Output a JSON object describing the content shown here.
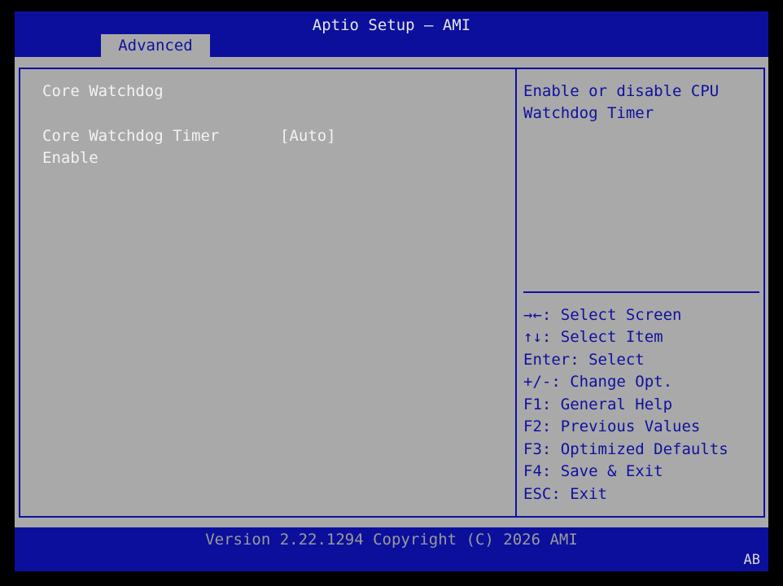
{
  "header": {
    "title": "Aptio Setup – AMI",
    "tabs": [
      {
        "label": "Advanced"
      }
    ]
  },
  "main": {
    "section_title": "Core Watchdog",
    "settings": [
      {
        "label_line1": "Core Watchdog Timer",
        "label_line2": "Enable",
        "value": "[Auto]"
      }
    ]
  },
  "help": {
    "line1": "Enable or disable CPU",
    "line2": "Watchdog Timer"
  },
  "keys": [
    {
      "text": "→←: Select Screen"
    },
    {
      "text": "↑↓: Select Item"
    },
    {
      "text": "Enter: Select"
    },
    {
      "text": "+/-: Change Opt."
    },
    {
      "text": "F1: General Help"
    },
    {
      "text": "F2: Previous Values"
    },
    {
      "text": "F3: Optimized Defaults"
    },
    {
      "text": "F4: Save & Exit"
    },
    {
      "text": "ESC: Exit"
    }
  ],
  "footer": {
    "version": "Version 2.22.1294 Copyright (C) 2026 AMI",
    "badge": "AB"
  },
  "colors": {
    "header_bg": "#0b0f9c",
    "panel_bg": "#a9a9a9",
    "accent_blue": "#1010a0",
    "text_white": "#f2f2f2"
  }
}
